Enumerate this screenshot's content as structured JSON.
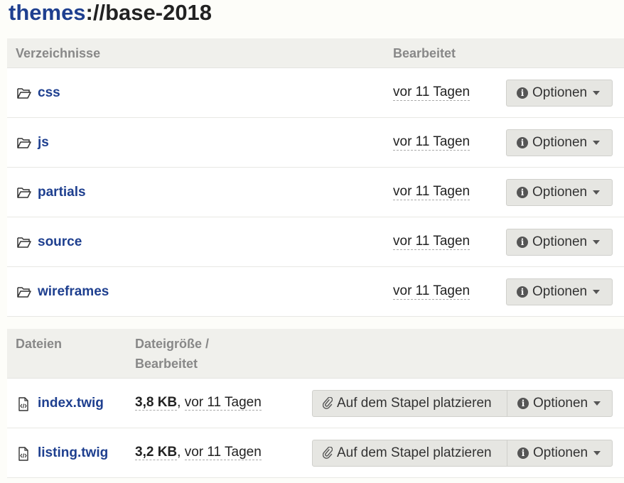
{
  "title": {
    "prefix": "themes",
    "path": "://base-2018"
  },
  "directories": {
    "header_name": "Verzeichnisse",
    "header_modified": "Bearbeitet",
    "rows": [
      {
        "name": "css",
        "modified": "vor 11 Tagen",
        "options_label": "Optionen"
      },
      {
        "name": "js",
        "modified": "vor 11 Tagen",
        "options_label": "Optionen"
      },
      {
        "name": "partials",
        "modified": "vor 11 Tagen",
        "options_label": "Optionen"
      },
      {
        "name": "source",
        "modified": "vor 11 Tagen",
        "options_label": "Optionen"
      },
      {
        "name": "wireframes",
        "modified": "vor 11 Tagen",
        "options_label": "Optionen"
      }
    ]
  },
  "files": {
    "header_name": "Dateien",
    "header_size_line1": "Dateigröße /",
    "header_size_line2": "Bearbeitet",
    "rows": [
      {
        "name": "index.twig",
        "size": "3,8 KB",
        "separator": ", ",
        "modified": "vor 11 Tagen",
        "stack_label": "Auf dem Stapel platzieren",
        "options_label": "Optionen"
      },
      {
        "name": "listing.twig",
        "size": "3,2 KB",
        "separator": ", ",
        "modified": "vor 11 Tagen",
        "stack_label": "Auf dem Stapel platzieren",
        "options_label": "Optionen"
      }
    ]
  },
  "icons": {
    "directory": "folder-open-icon",
    "file": "file-code-icon",
    "info": "info-circle-icon",
    "caret": "caret-down-icon",
    "stack": "paperclip-icon"
  },
  "colors": {
    "link": "#1e3f8f",
    "header_bg": "#f0f0ec",
    "button_bg": "#e6e6e2"
  }
}
